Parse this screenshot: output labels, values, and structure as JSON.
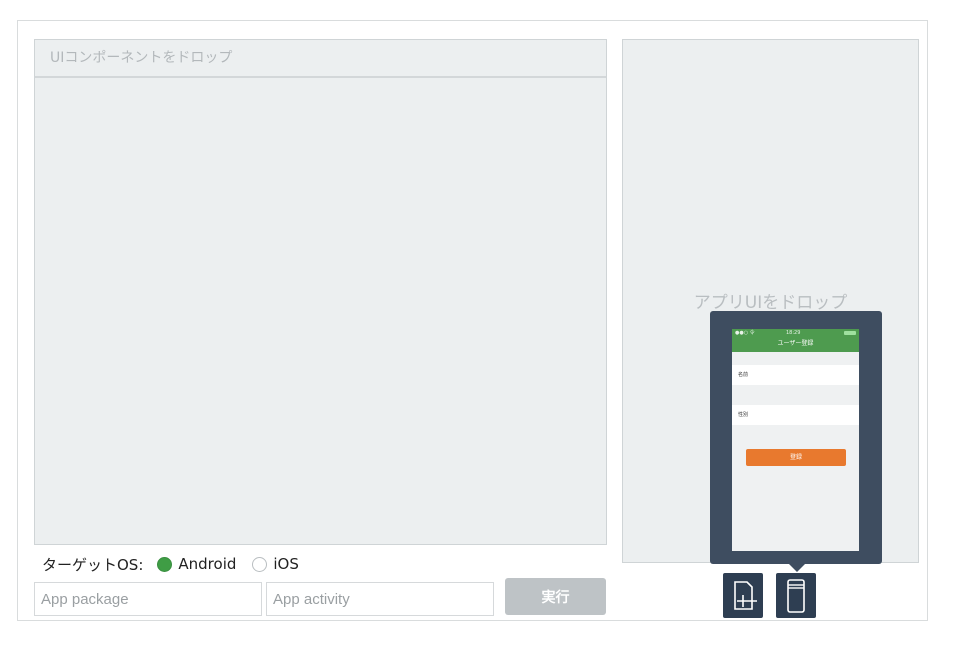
{
  "left_panel": {
    "header_placeholder": "UIコンポーネントをドロップ"
  },
  "right_panel": {
    "placeholder": "アプリUIをドロップ"
  },
  "target_os": {
    "label": "ターゲットOS:",
    "options": [
      {
        "label": "Android",
        "selected": true
      },
      {
        "label": "iOS",
        "selected": false
      }
    ]
  },
  "inputs": {
    "app_package": {
      "placeholder": "App package",
      "value": ""
    },
    "app_activity": {
      "placeholder": "App activity",
      "value": ""
    }
  },
  "run_button": {
    "label": "実行"
  },
  "preview": {
    "status_left": "●●○ 令",
    "status_time": "18:29",
    "title": "ユーザー登録",
    "field_name": "名前",
    "field_gender": "性別",
    "submit_label": "登録"
  },
  "colors": {
    "android_selected": "#3f9d45",
    "navbar_green": "#4e9b4f",
    "submit_orange": "#e8792e",
    "popup_bg": "#3e4d60",
    "tool_button_bg": "#2e3e52",
    "run_button_bg": "#bec3c6"
  },
  "toolbar": {
    "icons": [
      "add-screen-icon",
      "device-icon"
    ]
  }
}
